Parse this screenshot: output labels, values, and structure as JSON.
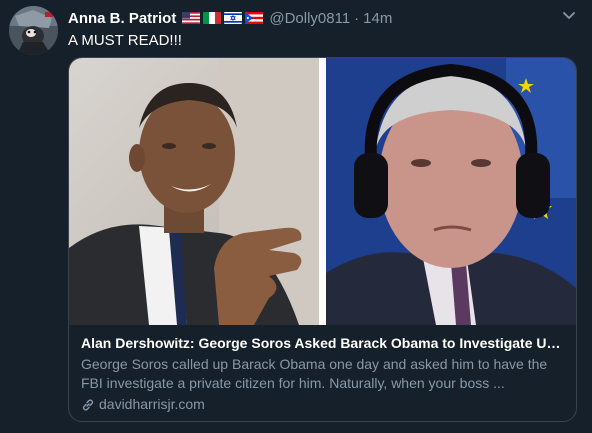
{
  "author": {
    "display_name": "Anna B. Patriot",
    "handle": "@Dolly0811",
    "separator": "·",
    "time": "14m",
    "flags": [
      "us-flag-icon",
      "italy-flag-icon",
      "israel-flag-icon",
      "puerto-rico-flag-icon"
    ]
  },
  "tweet": {
    "text": "A MUST READ!!!"
  },
  "card": {
    "title": "Alan Dershowitz: George Soros Asked Barack Obama to Investigate Und...",
    "description": "George Soros called up Barack Obama one day and asked him to have the FBI investigate a private citizen for him. Naturally, when your boss ...",
    "domain": "davidharrisjr.com",
    "image_left_subject": "man-in-suit-gesturing-photo",
    "image_right_subject": "man-with-headphones-photo"
  },
  "colors": {
    "background": "#15202b",
    "secondary_text": "#8899a6",
    "border": "#38444d"
  }
}
